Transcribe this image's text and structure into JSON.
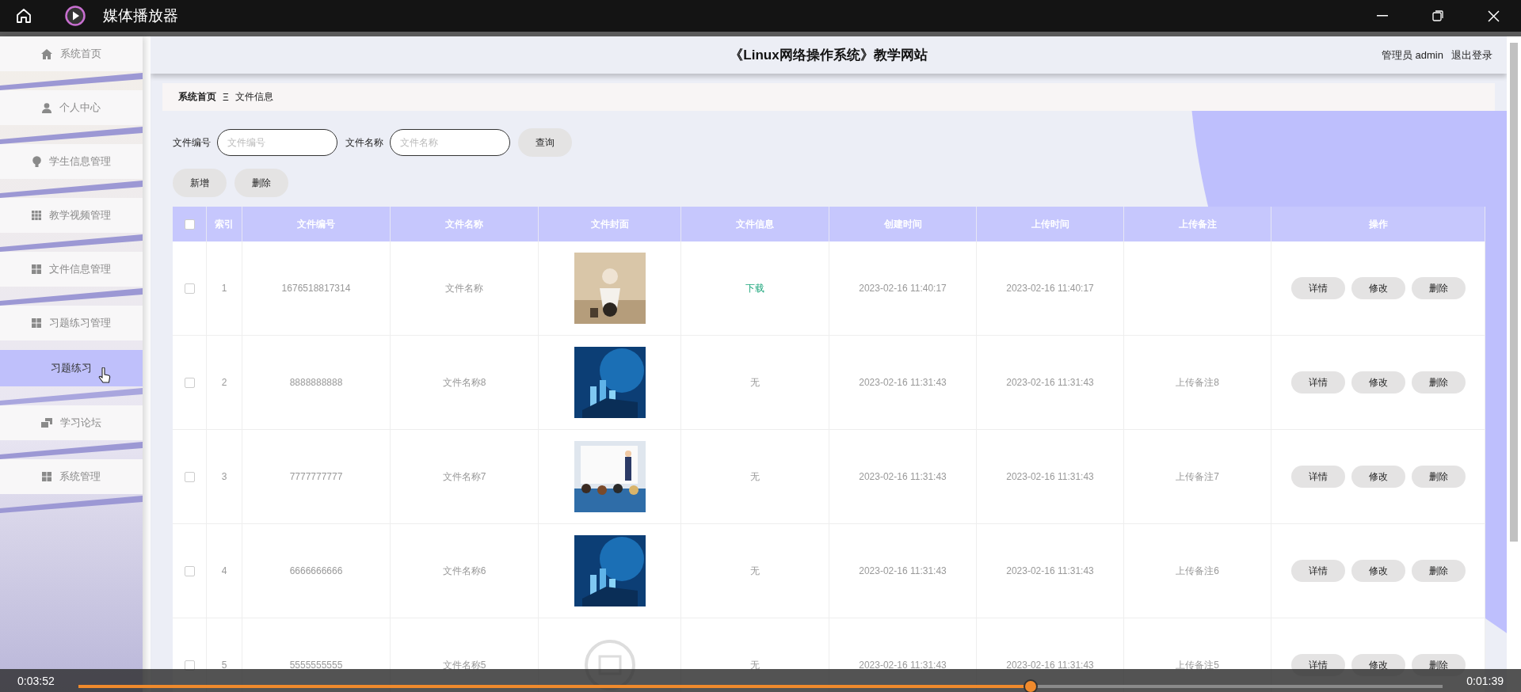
{
  "window": {
    "title": "媒体播放器"
  },
  "site": {
    "title": "《Linux网络操作系统》教学网站",
    "user": "管理员 admin",
    "logout": "退出登录"
  },
  "sidebar": {
    "items": [
      {
        "label": "系统首页",
        "selected": false
      },
      {
        "label": "个人中心",
        "selected": false
      },
      {
        "label": "学生信息管理",
        "selected": false
      },
      {
        "label": "教学视频管理",
        "selected": false
      },
      {
        "label": "文件信息管理",
        "selected": false
      },
      {
        "label": "习题练习管理",
        "selected": false,
        "children": [
          {
            "label": "习题练习",
            "selected": true
          }
        ]
      },
      {
        "label": "学习论坛",
        "selected": false
      },
      {
        "label": "系统管理",
        "selected": false
      }
    ]
  },
  "breadcrumb": [
    "系统首页",
    "Ξ",
    "文件信息"
  ],
  "search": {
    "fields": [
      {
        "label": "文件编号",
        "placeholder": "文件编号"
      },
      {
        "label": "文件名称",
        "placeholder": "文件名称"
      }
    ],
    "button": "查询"
  },
  "actions": [
    "新增",
    "删除"
  ],
  "table": {
    "select_all_checked": false,
    "columns": [
      "索引",
      "文件编号",
      "文件名称",
      "文件封面",
      "文件信息",
      "创建时间",
      "上传时间",
      "上传备注",
      "操作"
    ],
    "rows": [
      {
        "checked": false,
        "index": "1",
        "number": "1676518817314",
        "name": "文件名称",
        "info": {
          "kind": "link",
          "text": "下载"
        },
        "created": "2023-02-16 11:40:17",
        "uploaded": "2023-02-16 11:40:17",
        "buttons": [
          "详情",
          "修改",
          "删除"
        ]
      },
      {
        "checked": false,
        "index": "2",
        "number": "8888888888",
        "name": "文件名称8",
        "info": {
          "kind": "text",
          "text": "无"
        },
        "created": "2023-02-16 11:31:43",
        "uploaded": "2023-02-16 11:31:43",
        "note": "上传备注8",
        "buttons": [
          "详情",
          "修改",
          "删除"
        ]
      },
      {
        "checked": false,
        "index": "3",
        "number": "7777777777",
        "name": "文件名称7",
        "info": {
          "kind": "text",
          "text": "无"
        },
        "created": "2023-02-16 11:31:43",
        "uploaded": "2023-02-16 11:31:43",
        "note": "上传备注7",
        "buttons": [
          "详情",
          "修改",
          "删除"
        ]
      },
      {
        "checked": false,
        "index": "4",
        "number": "6666666666",
        "name": "文件名称6",
        "info": {
          "kind": "text",
          "text": "无"
        },
        "created": "2023-02-16 11:31:43",
        "uploaded": "2023-02-16 11:31:43",
        "note": "上传备注6",
        "buttons": [
          "详情",
          "修改",
          "删除"
        ]
      },
      {
        "checked": false,
        "index": "5",
        "number": "5555555555",
        "name": "文件名称5",
        "info": {
          "kind": "text",
          "text": "无"
        },
        "created": "2023-02-16 11:31:43",
        "uploaded": "2023-02-16 11:31:43",
        "note": "上传备注5",
        "buttons": [
          "详情",
          "修改",
          "删除"
        ]
      }
    ]
  },
  "player": {
    "elapsed": "0:03:52",
    "remaining": "0:01:39",
    "level": 0.698
  }
}
